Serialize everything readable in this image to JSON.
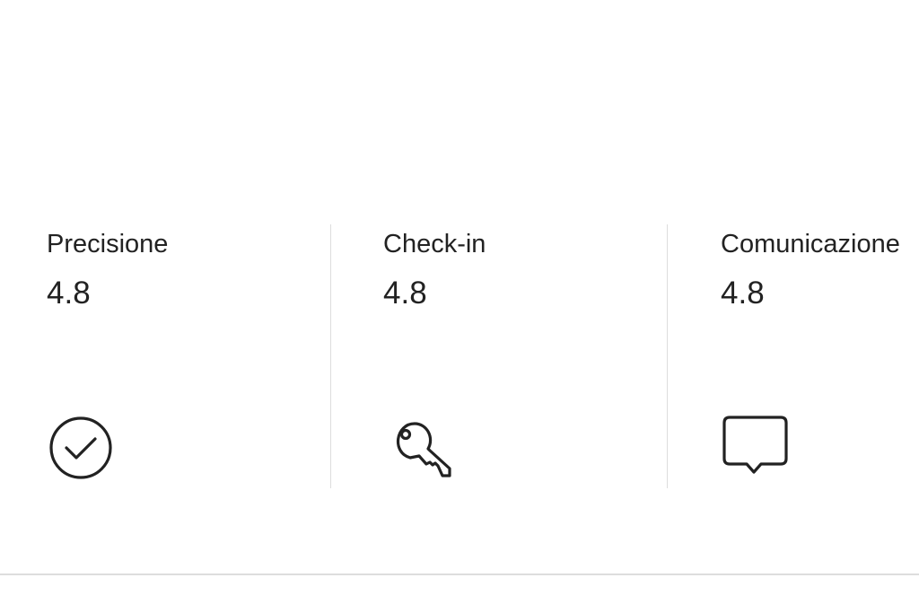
{
  "ratings": [
    {
      "label": "Precisione",
      "value": "4.8",
      "icon": "check-circle-icon"
    },
    {
      "label": "Check-in",
      "value": "4.8",
      "icon": "key-icon"
    },
    {
      "label": "Comunicazione",
      "value": "4.8",
      "icon": "chat-bubble-icon"
    }
  ],
  "colors": {
    "text": "#222222",
    "divider": "#dddddd",
    "background": "#ffffff"
  }
}
